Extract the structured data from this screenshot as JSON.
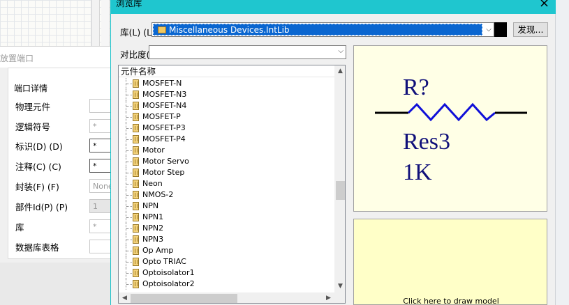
{
  "port_dialog": {
    "title": "放置端口",
    "group_title": "端口详情",
    "rows": [
      {
        "label": "物理元件",
        "value": ""
      },
      {
        "label": "逻辑符号",
        "value": "*"
      },
      {
        "label": "标识(D) (D)",
        "value": "*"
      },
      {
        "label": "注释(C) (C)",
        "value": "*"
      },
      {
        "label": "封装(F) (F)",
        "value": "None"
      },
      {
        "label": "部件Id(P) (P)",
        "value": "1"
      },
      {
        "label": "库",
        "value": "*"
      },
      {
        "label": "数据库表格",
        "value": ""
      }
    ]
  },
  "browse_dialog": {
    "title": "浏览库",
    "close_glyph": "×",
    "library_label": "库(L) (L)",
    "library_value": "Miscellaneous Devices.IntLib",
    "find_button": "发现...",
    "compare_label": "对比度(",
    "list_header": "元件名称",
    "components": [
      "MOSFET-N",
      "MOSFET-N3",
      "MOSFET-N4",
      "MOSFET-P",
      "MOSFET-P3",
      "MOSFET-P4",
      "Motor",
      "Motor Servo",
      "Motor Step",
      "Neon",
      "NMOS-2",
      "NPN",
      "NPN1",
      "NPN2",
      "NPN3",
      "Op Amp",
      "Opto TRIAC",
      "Optoisolator1",
      "Optoisolator2"
    ],
    "preview": {
      "designator": "R?",
      "name": "Res3",
      "value": "1K"
    },
    "model_hint": "Click here to draw model"
  },
  "colors": {
    "title_bar": "#1fc6cf",
    "selection": "#0a66d0",
    "schematic_text": "#10107a",
    "schematic_wire_blue": "#1010d8"
  }
}
